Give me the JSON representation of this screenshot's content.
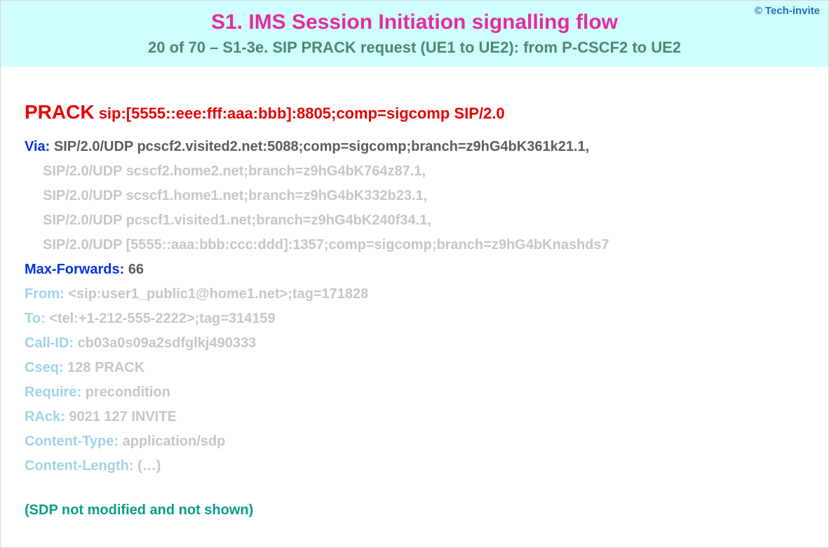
{
  "copyright": "© Tech-invite",
  "title": "S1. IMS Session Initiation signalling flow",
  "subtitle": "20 of 70 – S1-3e. SIP PRACK request (UE1 to UE2): from P-CSCF2 to UE2",
  "request": {
    "method": "PRACK",
    "uri": "sip:[5555::eee:fff:aaa:bbb]:8805;comp=sigcomp SIP/2.0"
  },
  "via": {
    "name": "Via:",
    "first": "SIP/2.0/UDP pcscf2.visited2.net:5088;comp=sigcomp;branch=z9hG4bK361k21.1,",
    "rest": [
      "SIP/2.0/UDP scscf2.home2.net;branch=z9hG4bK764z87.1,",
      "SIP/2.0/UDP scscf1.home1.net;branch=z9hG4bK332b23.1,",
      "SIP/2.0/UDP pcscf1.visited1.net;branch=z9hG4bK240f34.1,",
      "SIP/2.0/UDP [5555::aaa:bbb:ccc:ddd]:1357;comp=sigcomp;branch=z9hG4bKnashds7"
    ]
  },
  "maxForwards": {
    "name": "Max-Forwards:",
    "value": "66"
  },
  "fadedHeaders": [
    {
      "name": "From:",
      "value": "<sip:user1_public1@home1.net>;tag=171828"
    },
    {
      "name": "To:",
      "value": "<tel:+1-212-555-2222>;tag=314159"
    },
    {
      "name": "Call-ID:",
      "value": "cb03a0s09a2sdfglkj490333"
    },
    {
      "name": "Cseq:",
      "value": "128 PRACK"
    },
    {
      "name": "Require:",
      "value": "precondition"
    },
    {
      "name": "RAck:",
      "value": "9021 127 INVITE"
    },
    {
      "name": "Content-Type:",
      "value": "application/sdp"
    },
    {
      "name": "Content-Length:",
      "value": "(…)"
    }
  ],
  "sdpNote": "(SDP not modified and not shown)"
}
